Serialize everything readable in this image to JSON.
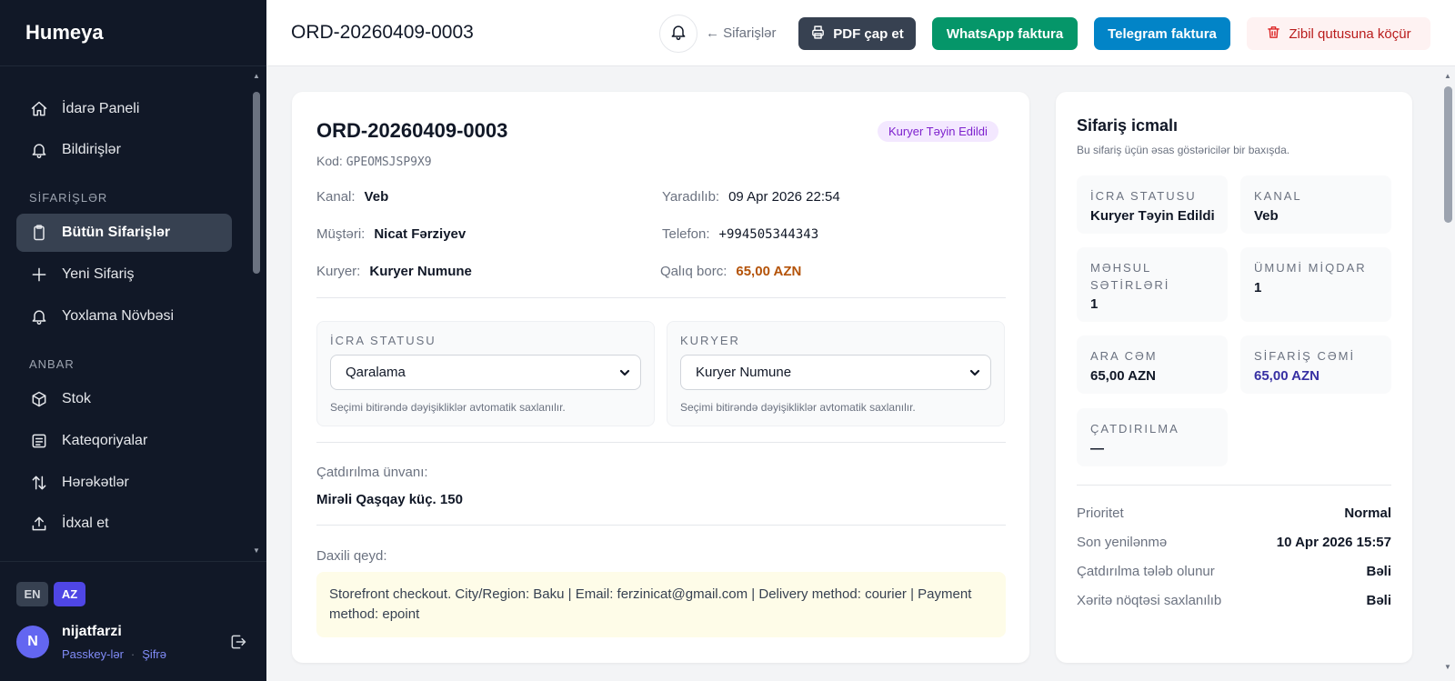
{
  "app": {
    "brand": "Humeya"
  },
  "sidebar": {
    "items": [
      {
        "label": "İdarə Paneli",
        "icon": "home-icon"
      },
      {
        "label": "Bildirişlər",
        "icon": "bell-icon"
      },
      {
        "label": "Bütün Sifarişlər",
        "icon": "clipboard-icon",
        "active": true
      },
      {
        "label": "Yeni Sifariş",
        "icon": "plus-icon"
      },
      {
        "label": "Yoxlama Növbəsi",
        "icon": "bell-icon"
      },
      {
        "label": "Stok",
        "icon": "box-icon"
      },
      {
        "label": "Kateqoriyalar",
        "icon": "list-icon"
      },
      {
        "label": "Hərəkətlər",
        "icon": "arrows-updown-icon"
      },
      {
        "label": "İdxal et",
        "icon": "upload-icon"
      }
    ],
    "sections": {
      "orders": "SİFARİŞLƏR",
      "warehouse": "ANBAR"
    },
    "lang": {
      "en": "EN",
      "az": "AZ"
    },
    "user": {
      "initial": "N",
      "name": "nijatfarzi",
      "passkeys": "Passkey-lər",
      "dot": "·",
      "password": "Şifrə"
    }
  },
  "header": {
    "title": "ORD-20260409-0003",
    "back": "← Sifarişlər",
    "pdf": "PDF çap et",
    "whatsapp": "WhatsApp faktura",
    "telegram": "Telegram faktura",
    "trash": "Zibil qutusuna köçür"
  },
  "order": {
    "title": "ORD-20260409-0003",
    "status_badge": "Kuryer Təyin Edildi",
    "code_label": "Kod:",
    "code": "GPEOMSJSP9X9",
    "fields": {
      "channel_label": "Kanal:",
      "channel": "Veb",
      "created_label": "Yaradılıb:",
      "created": "09 Apr 2026 22:54",
      "customer_label": "Müştəri:",
      "customer": "Nicat Fərziyev",
      "phone_label": "Telefon:",
      "phone": "+994505344343",
      "courier_label": "Kuryer:",
      "courier": "Kuryer Numune",
      "debt_label": "Qalıq borc:",
      "debt": "65,00 AZN"
    },
    "status_select": {
      "label": "İCRA STATUSU",
      "value": "Qaralama",
      "hint": "Seçimi bitirəndə dəyişikliklər avtomatik saxlanılır."
    },
    "courier_select": {
      "label": "KURYER",
      "value": "Kuryer Numune",
      "hint": "Seçimi bitirəndə dəyişikliklər avtomatik saxlanılır."
    },
    "address_label": "Çatdırılma ünvanı:",
    "address": "Mirəli Qaşqay küç. 150",
    "note_label": "Daxili qeyd:",
    "note": "Storefront checkout. City/Region: Baku | Email: ferzinicat@gmail.com | Delivery method: courier | Payment method: epoint"
  },
  "summary": {
    "title": "Sifariş icmalı",
    "subtitle": "Bu sifariş üçün əsas göstəricilər bir baxışda.",
    "stats": {
      "status_label": "İCRA STATUSU",
      "status": "Kuryer Təyin Edildi",
      "channel_label": "KANAL",
      "channel": "Veb",
      "lines_label": "MƏHSUL SƏTİRLƏRİ",
      "lines": "1",
      "qty_label": "ÜMUMİ MİQDAR",
      "qty": "1",
      "subtotal_label": "ARA CƏM",
      "subtotal": "65,00 AZN",
      "total_label": "SİFARİŞ CƏMİ",
      "total": "65,00 AZN",
      "delivery_label": "ÇATDIRILMA",
      "delivery": "—"
    },
    "rows": {
      "priority_label": "Prioritet",
      "priority": "Normal",
      "updated_label": "Son yenilənmə",
      "updated": "10 Apr 2026 15:57",
      "delivery_req_label": "Çatdırılma tələb olunur",
      "delivery_req": "Bəli",
      "map_label": "Xəritə nöqtəsi saxlanılıb",
      "map": "Bəli"
    }
  },
  "colors": {
    "sidebar_bg": "#111827",
    "accent": "#4f46e5",
    "whatsapp": "#059669",
    "telegram": "#0284c7",
    "danger": "#b91c1c",
    "debt": "#b45309"
  }
}
